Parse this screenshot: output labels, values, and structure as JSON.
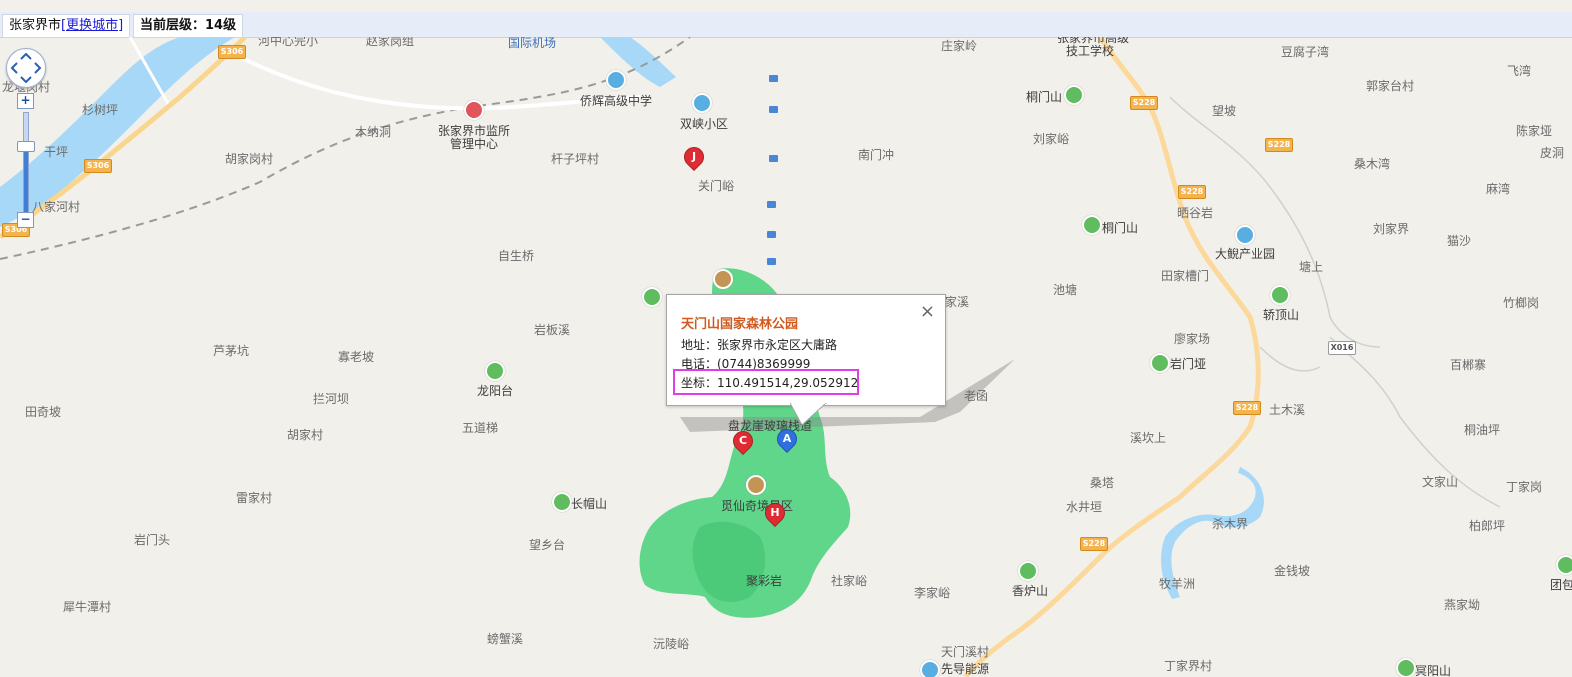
{
  "header": {
    "city": "张家界市",
    "change_city": "[更换城市]",
    "level": "当前层级：14级"
  },
  "popup": {
    "title": "天门山国家森林公园",
    "address": "地址：张家界市永定区大庸路",
    "phone": "电话：(0744)8369999",
    "coords": "坐标：110.491514,29.052912",
    "close": "×"
  },
  "zoom": {
    "in": "+",
    "out": "−"
  },
  "markers": {
    "A": "A",
    "C": "C",
    "H": "H",
    "J": "J"
  },
  "roads": {
    "s306_a": "S306",
    "s306_b": "S306",
    "s306_c": "S306",
    "s228_a": "S228",
    "s228_b": "S228",
    "s228_c": "S228",
    "s228_d": "S228",
    "s228_e": "S228",
    "x016": "X016"
  },
  "labels": {
    "hezhong": "河中心完小",
    "zhaojia": "赵家岗组",
    "airport": "国际机场",
    "zhuangjialing": "庄家岭",
    "school1": "张家界市高级",
    "school2": "技工学校",
    "doufuziwan": "豆腐子湾",
    "feiwan": "飞湾",
    "longmen": "龙堰岗村",
    "shanshuping": "杉树坪",
    "qiaohui": "侨辉高级中学",
    "shuangxia": "双峡小区",
    "tongmenshan1": "桐门山",
    "guojiatai": "郭家台村",
    "wangpo": "望坡",
    "munadong": "木纳洞",
    "jianguan1": "张家界市监所",
    "jianguan2": "管理中心",
    "liujiayu": "刘家峪",
    "chenjiaya": "陈家垭",
    "pidou": "皮洞",
    "ganping": "干坪",
    "hujiagang": "胡家岗村",
    "qianzi": "杆子坪村",
    "nanmenchong": "南门冲",
    "sangmuwan": "桑木湾",
    "guanmenyu": "关门峪",
    "mafeng": "麻湾",
    "shaigu": "晒谷岩",
    "bajiahe": "八家河村",
    "tongmenshan2": "桐门山",
    "liujiajie": "刘家界",
    "maosha": "猫沙",
    "dapo": "大鲵产业园",
    "zishengqiao": "自生桥",
    "tianjiacao": "田家槽门",
    "tangshang": "塘上",
    "chitang": "池塘",
    "zhuqiao": "竹榔岗",
    "yanbanxi": "岩板溪",
    "maoxi": "家溪",
    "jiaodingshan": "轿顶山",
    "lujiaping": "芦茅坑",
    "guaolaopo": "寡老坡",
    "liaojiachang": "廖家场",
    "yanmenya": "岩门垭",
    "baibing": "百郴寨",
    "longyangtai": "龙阳台",
    "lanheban": "拦河坝",
    "laohan": "老函",
    "tianqipo": "田奇坡",
    "wudaoti": "五道梯",
    "panlong": "盘龙崖玻璃栈道",
    "xikanshang": "溪坎上",
    "tumuxi": "土木溪",
    "tongyouping": "桐油坪",
    "hujiacun": "胡家村",
    "sangta": "桑塔",
    "wenjiashan": "文家山",
    "dingjiagang": "丁家岗",
    "leijiacun": "雷家村",
    "changmaoshan": "长帽山",
    "mixian": "觅仙奇境景区",
    "shuijingtan": "水井垣",
    "baiplang": "柏郎坪",
    "yanmentou": "岩门头",
    "wangxiangtai": "望乡台",
    "shamujie": "杀木界",
    "xuniu": "犀牛潭村",
    "jucaiyan": "聚彩岩",
    "shejiayu": "社家峪",
    "xianglushan": "香炉山",
    "jinqianpo": "金钱坡",
    "muyangzhou": "牧羊洲",
    "yanjiapo": "燕家坳",
    "lijiayu": "李家峪",
    "pangxiexi": "螃蟹溪",
    "yuanlingyu": "沅陵峪",
    "tianmenxicun": "天门溪村",
    "xiandao": "先导能源",
    "dingjiajie": "丁家界村",
    "mingyangshan": "冥阳山",
    "tuanxi": "团包"
  },
  "colors": {
    "forest": "#5fd68a",
    "river": "#a7d8f7",
    "popup_title": "#d15a20",
    "highlight": "#e23be8"
  }
}
